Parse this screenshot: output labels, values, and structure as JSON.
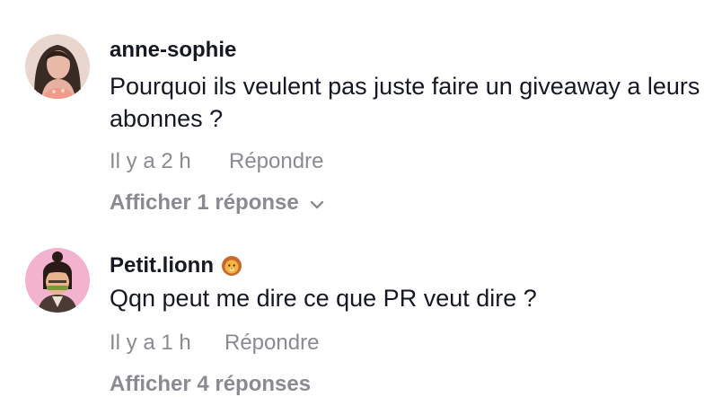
{
  "comments": [
    {
      "username": "anne-sophie",
      "text": "Pourquoi ils veulent pas juste faire un giveaway a leurs abonnes ?",
      "time": "Il y a 2 h",
      "reply_label": "Répondre",
      "view_replies": "Afficher 1 réponse",
      "avatar_icon": "profile-photo-icon"
    },
    {
      "username": "Petit.lionn",
      "badge_icon": "lion-face-emoji-icon",
      "text": "Qqn peut me dire ce que PR veut dire ?",
      "time": "Il y a 1 h",
      "reply_label": "Répondre",
      "view_replies": "Afficher 4 réponses",
      "avatar_icon": "cartoon-avatar-icon"
    }
  ],
  "colors": {
    "primary_text": "#161823",
    "secondary_text": "#8a8b91",
    "background": "#ffffff"
  }
}
